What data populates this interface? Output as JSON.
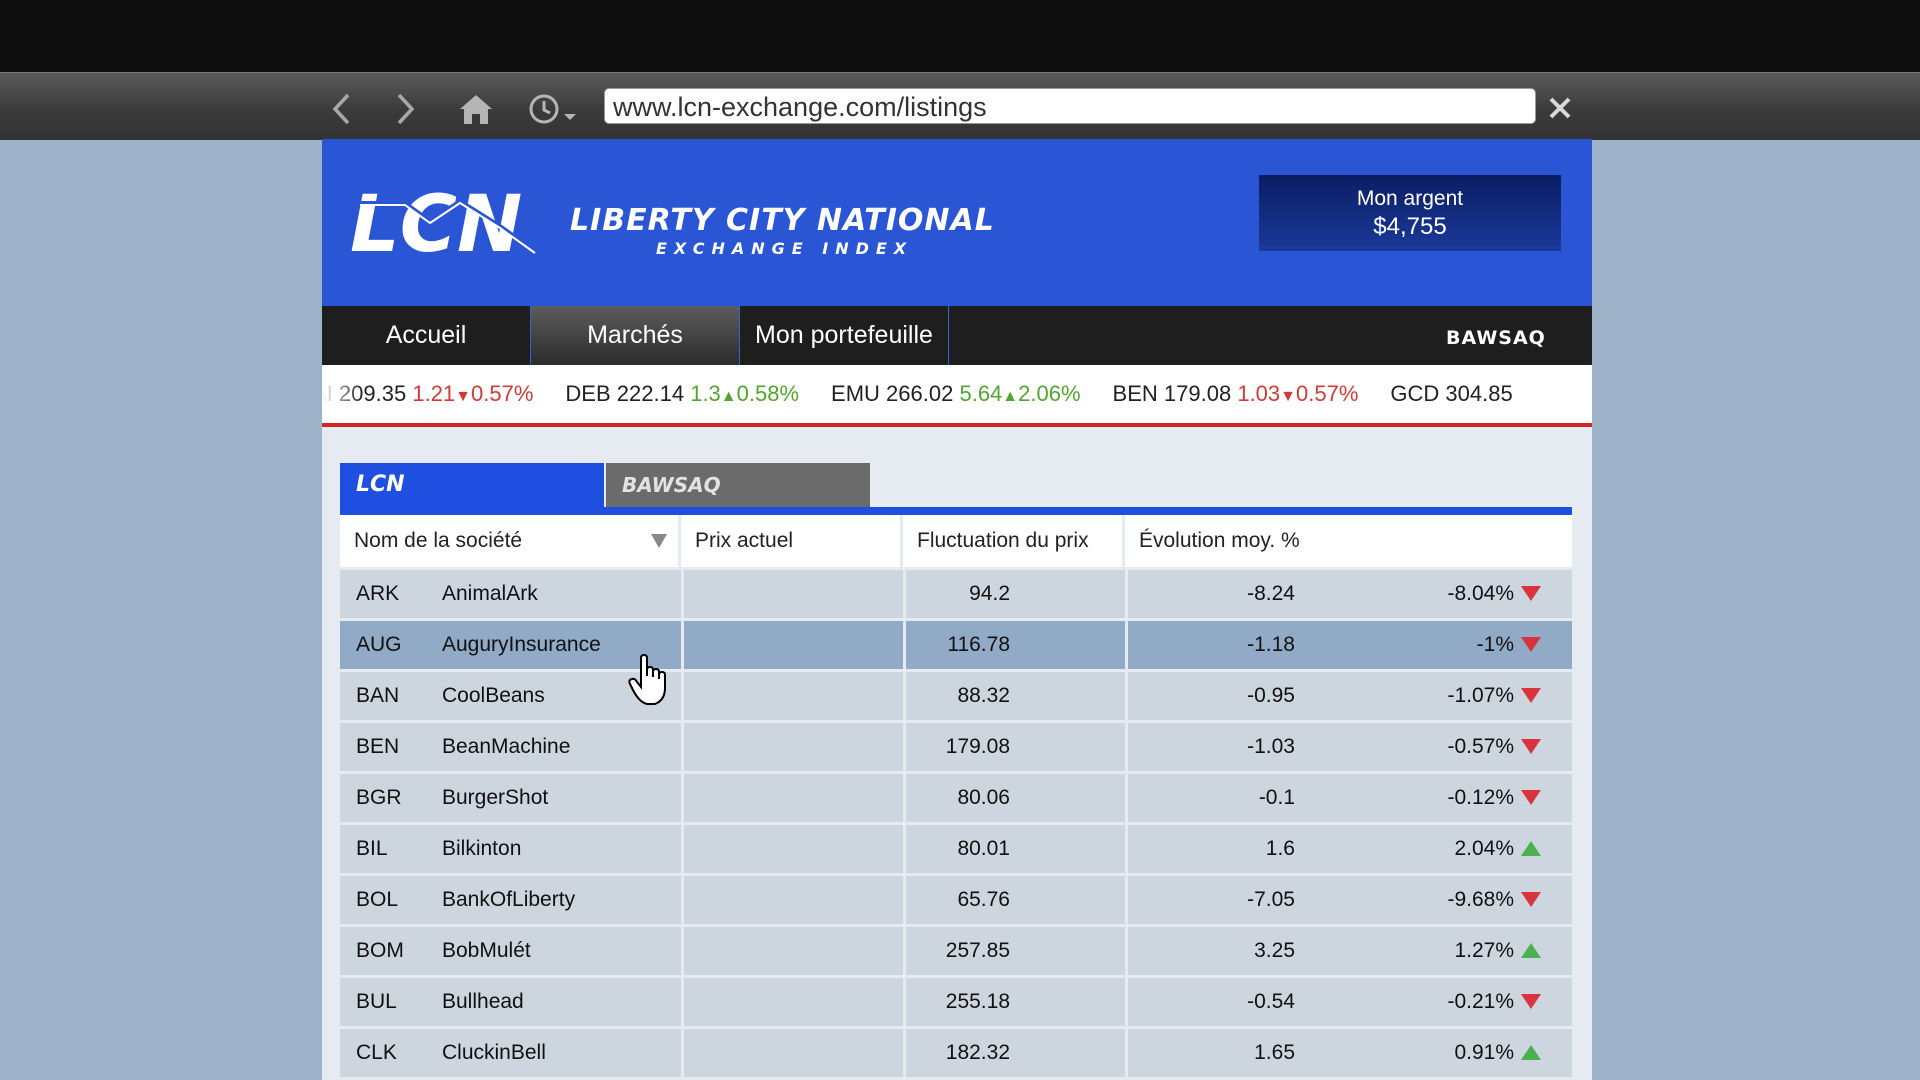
{
  "browser": {
    "url": "www.lcn-exchange.com/listings"
  },
  "header": {
    "logo_text": "LCN",
    "title": "LIBERTY CITY NATIONAL",
    "subtitle": "EXCHANGE INDEX",
    "money_label": "Mon argent",
    "money_value": "$4,755",
    "brand_color": "#2a56d6"
  },
  "nav": {
    "tabs": [
      {
        "label": "Accueil"
      },
      {
        "label": "Marchés"
      },
      {
        "label": "Mon portefeuille"
      }
    ],
    "active": "Marchés",
    "partner_logo": "BAWSAQ"
  },
  "ticker": [
    {
      "symbol": "AI",
      "price": "209.35",
      "change": "1.21",
      "dir": "down",
      "pct": "0.57%"
    },
    {
      "symbol": "DEB",
      "price": "222.14",
      "change": "1.3",
      "dir": "up",
      "pct": "0.58%"
    },
    {
      "symbol": "EMU",
      "price": "266.02",
      "change": "5.64",
      "dir": "up",
      "pct": "2.06%"
    },
    {
      "symbol": "BEN",
      "price": "179.08",
      "change": "1.03",
      "dir": "down",
      "pct": "0.57%"
    },
    {
      "symbol": "GCD",
      "price": "304.85",
      "change": "",
      "dir": "",
      "pct": ""
    }
  ],
  "index_tabs": {
    "lcn": "LCN",
    "bawsaq": "BAWSAQ"
  },
  "table": {
    "columns": [
      "Nom de la société",
      "Prix actuel",
      "Fluctuation du prix",
      "Évolution moy. %"
    ],
    "rows": [
      {
        "symbol": "ARK",
        "name": "AnimalArk",
        "price": "94.2",
        "change": "-8.24",
        "pct": "-8.04%",
        "dir": "down"
      },
      {
        "symbol": "AUG",
        "name": "AuguryInsurance",
        "price": "116.78",
        "change": "-1.18",
        "pct": "-1%",
        "dir": "down"
      },
      {
        "symbol": "BAN",
        "name": "CoolBeans",
        "price": "88.32",
        "change": "-0.95",
        "pct": "-1.07%",
        "dir": "down"
      },
      {
        "symbol": "BEN",
        "name": "BeanMachine",
        "price": "179.08",
        "change": "-1.03",
        "pct": "-0.57%",
        "dir": "down"
      },
      {
        "symbol": "BGR",
        "name": "BurgerShot",
        "price": "80.06",
        "change": "-0.1",
        "pct": "-0.12%",
        "dir": "down"
      },
      {
        "symbol": "BIL",
        "name": "Bilkinton",
        "price": "80.01",
        "change": "1.6",
        "pct": "2.04%",
        "dir": "up"
      },
      {
        "symbol": "BOL",
        "name": "BankOfLiberty",
        "price": "65.76",
        "change": "-7.05",
        "pct": "-9.68%",
        "dir": "down"
      },
      {
        "symbol": "BOM",
        "name": "BobMulét",
        "price": "257.85",
        "change": "3.25",
        "pct": "1.27%",
        "dir": "up"
      },
      {
        "symbol": "BUL",
        "name": "Bullhead",
        "price": "255.18",
        "change": "-0.54",
        "pct": "-0.21%",
        "dir": "down"
      },
      {
        "symbol": "CLK",
        "name": "CluckinBell",
        "price": "182.32",
        "change": "1.65",
        "pct": "0.91%",
        "dir": "up"
      }
    ],
    "selected_row": "AUG",
    "up_color": "#4caf50",
    "down_color": "#d9343b"
  }
}
